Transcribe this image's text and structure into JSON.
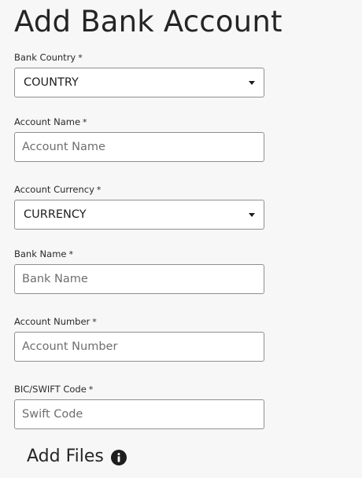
{
  "page": {
    "title": "Add Bank Account"
  },
  "form": {
    "required_marker": "*",
    "bank_country": {
      "label": "Bank Country",
      "value": "COUNTRY"
    },
    "account_name": {
      "label": "Account Name",
      "value": "",
      "placeholder": "Account Name"
    },
    "account_currency": {
      "label": "Account Currency",
      "value": "CURRENCY"
    },
    "bank_name": {
      "label": "Bank Name",
      "value": "",
      "placeholder": "Bank Name"
    },
    "account_number": {
      "label": "Account Number",
      "value": "",
      "placeholder": "Account Number"
    },
    "swift_code": {
      "label": "BIC/SWIFT Code",
      "value": "",
      "placeholder": "Swift Code"
    }
  },
  "files": {
    "title": "Add Files",
    "icon": "info-icon"
  },
  "colors": {
    "background": "#f7f7f7",
    "field_border": "#8f8f8f",
    "text": "#222222",
    "placeholder": "#6e6e6e"
  }
}
